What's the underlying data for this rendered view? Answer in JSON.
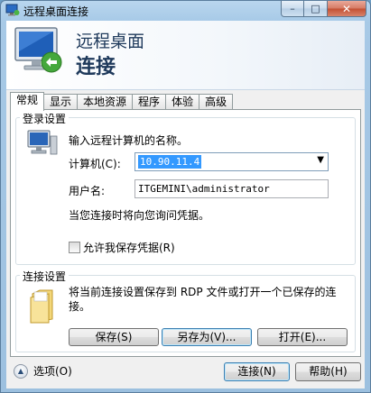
{
  "window": {
    "title": "远程桌面连接",
    "minimize": "–",
    "maximize": "□",
    "close": "✕"
  },
  "header": {
    "line1": "远程桌面",
    "line2": "连接"
  },
  "tabs": [
    "常规",
    "显示",
    "本地资源",
    "程序",
    "体验",
    "高级"
  ],
  "logon": {
    "legend": "登录设置",
    "prompt": "输入远程计算机的名称。",
    "computer_label": "计算机(C):",
    "computer_value": "10.90.11.4",
    "username_label": "用户名:",
    "username_value": "ITGEMINI\\administrator",
    "credentials_note": "当您连接时将向您询问凭据。",
    "allow_save_label": "允许我保存凭据(R)",
    "allow_save_checked": false
  },
  "connection": {
    "legend": "连接设置",
    "description": "将当前连接设置保存到 RDP 文件或打开一个已保存的连接。",
    "save_label": "保存(S)",
    "save_as_label": "另存为(V)...",
    "open_label": "打开(E)..."
  },
  "footer": {
    "options_label": "选项(O)",
    "connect_label": "连接(N)",
    "help_label": "帮助(H)"
  },
  "icons": {
    "app": "remote-desktop-icon",
    "header": "monitor-icon",
    "computer": "computer-icon",
    "folder": "folder-icon",
    "options": "chevron-up-icon"
  }
}
